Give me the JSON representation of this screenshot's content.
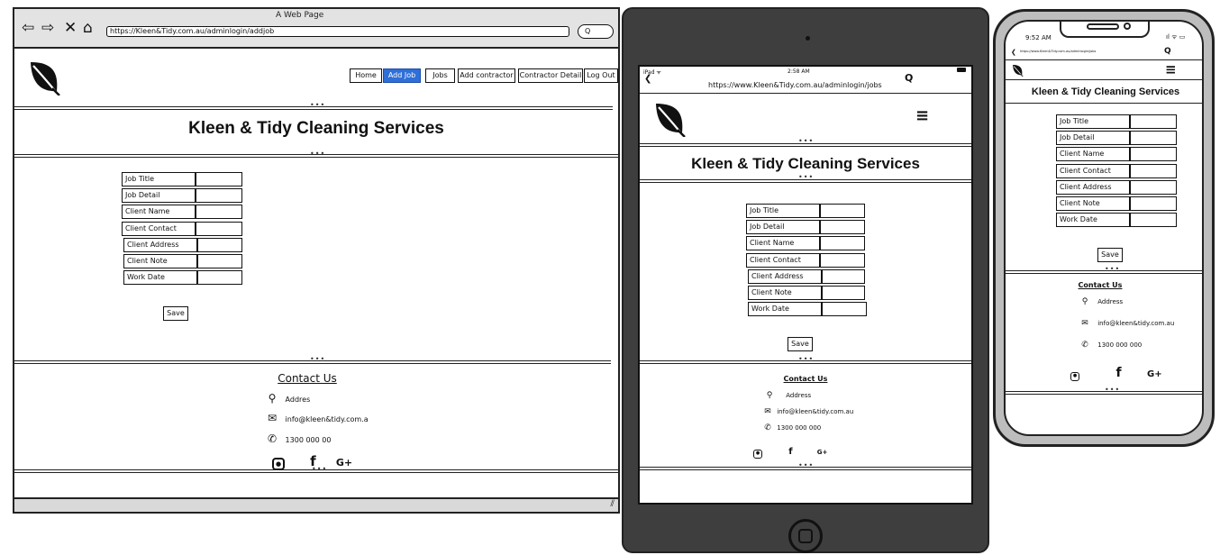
{
  "desktop": {
    "window_title": "A Web Page",
    "url": "https://Kleen&Tidy.com.au/adminlogin/addjob",
    "nav": [
      "Home",
      "Add Job",
      "Jobs",
      "Add contractor",
      "Contractor Detail",
      "Log Out"
    ],
    "active_nav": "Add Job",
    "heading": "Kleen & Tidy Cleaning Services",
    "form_labels": [
      "Job Title",
      "Job Detail",
      "Client Name",
      "Client Contact",
      "Client Address",
      "Client Note",
      "Work Date"
    ],
    "save_label": "Save",
    "contact_title": "Contact Us",
    "address": "Addres",
    "email": "info@kleen&tidy.com.a",
    "phone": "1300 000 00"
  },
  "tablet": {
    "status_left": "iPad",
    "time": "2:58 AM",
    "url": "https://www.Kleen&Tidy.com.au/adminlogin/jobs",
    "heading": "Kleen & Tidy Cleaning Services",
    "form_labels": [
      "Job Title",
      "Job Detail",
      "Client Name",
      "Client Contact",
      "Client Address",
      "Client Note",
      "Work Date"
    ],
    "save_label": "Save",
    "contact_title": "Contact Us",
    "address": "Address",
    "email": "info@kleen&tidy.com.au",
    "phone": "1300 000 000"
  },
  "phone": {
    "time": "9:52 AM",
    "url": "https://www.Kleen&Tidy.com.au/adminlogin/jobs",
    "heading": "Kleen & Tidy Cleaning Services",
    "form_labels": [
      "Job Title",
      "Job Detail",
      "Client Name",
      "Client Contact",
      "Client Address",
      "Client Note",
      "Work Date"
    ],
    "save_label": "Save",
    "contact_title": "Contact Us",
    "address": "Address",
    "email": "info@kleen&tidy.com.au",
    "phone": "1300 000 000"
  },
  "icons": {
    "back": "back-arrow-icon",
    "forward": "forward-arrow-icon",
    "stop": "close-icon",
    "home": "home-icon",
    "search": "search-icon",
    "menu": "hamburger-menu-icon",
    "logo": "leaf-logo-icon",
    "location": "location-pin-icon",
    "email": "envelope-icon",
    "phone": "phone-icon",
    "instagram": "instagram-icon",
    "facebook": "facebook-icon",
    "google_plus": "google-plus-icon"
  },
  "colors": {
    "active_nav": "#2f6fd8",
    "tablet_bezel": "#3e3e3e",
    "phone_bezel": "#bdbdbd"
  }
}
